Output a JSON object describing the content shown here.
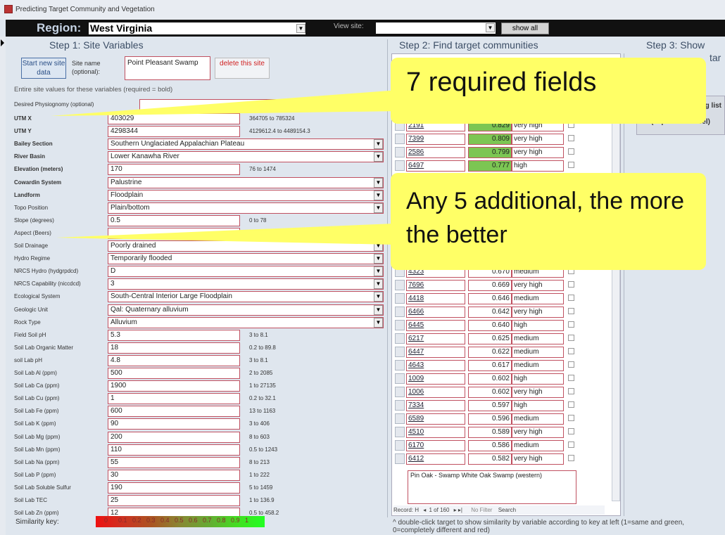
{
  "window": {
    "title": "Predicting Target Community and Vegetation"
  },
  "topbar": {
    "region_label": "Region:",
    "region_value": "West Virginia",
    "view_site_label": "View site:",
    "view_site_value": "",
    "show_all_label": "show all"
  },
  "step1": {
    "title": "Step 1: Site Variables",
    "start_new_label": "Start new site data",
    "site_name_label": "Site name (optional):",
    "site_name_value": "Point Pleasant Swamp",
    "delete_label": "delete this site",
    "instructions": "Entire site values for these variables (required = bold)",
    "desired_physiognomy_label": "Desired Physiognomy (optional)",
    "rows": [
      {
        "label": "UTM X",
        "value": "403029",
        "range": "364705 to 785324",
        "bold": true,
        "dropdown": false
      },
      {
        "label": "UTM Y",
        "value": "4298344",
        "range": "4129612.4 to 4489154.3",
        "bold": true,
        "dropdown": false
      },
      {
        "label": "Bailey Section",
        "value": "Southern Unglaciated Appalachian Plateau",
        "range": "",
        "bold": true,
        "dropdown": true
      },
      {
        "label": "River Basin",
        "value": "Lower Kanawha River",
        "range": "",
        "bold": true,
        "dropdown": true
      },
      {
        "label": "Elevation (meters)",
        "value": "170",
        "range": "76 to 1474",
        "bold": true,
        "dropdown": false
      },
      {
        "label": "Cowardin System",
        "value": "Palustrine",
        "range": "",
        "bold": true,
        "dropdown": true
      },
      {
        "label": "Landform",
        "value": "Floodplain",
        "range": "",
        "bold": true,
        "dropdown": true
      },
      {
        "label": "Topo Position",
        "value": "Plain/bottom",
        "range": "",
        "bold": false,
        "dropdown": true
      },
      {
        "label": "Slope (degrees)",
        "value": "0.5",
        "range": "0 to 78",
        "bold": false,
        "dropdown": false
      },
      {
        "label": "Aspect (Beers)",
        "value": "",
        "range": "0 to 1",
        "bold": false,
        "dropdown": false
      },
      {
        "label": "Soil Drainage",
        "value": "Poorly drained",
        "range": "",
        "bold": false,
        "dropdown": true
      },
      {
        "label": "Hydro Regime",
        "value": "Temporarily flooded",
        "range": "",
        "bold": false,
        "dropdown": true
      },
      {
        "label": "NRCS Hydro (hydgrpdcd)",
        "value": "D",
        "range": "",
        "bold": false,
        "dropdown": true
      },
      {
        "label": "NRCS Capability (niccdcd)",
        "value": "3",
        "range": "",
        "bold": false,
        "dropdown": true
      },
      {
        "label": "Ecological System",
        "value": "South-Central Interior Large Floodplain",
        "range": "",
        "bold": false,
        "dropdown": true
      },
      {
        "label": "Geologic Unit",
        "value": "Qal: Quaternary alluvium",
        "range": "",
        "bold": false,
        "dropdown": true
      },
      {
        "label": "Rock Type",
        "value": "Alluvium",
        "range": "",
        "bold": false,
        "dropdown": true
      },
      {
        "label": "Field Soil pH",
        "value": "5.3",
        "range": "3 to 8.1",
        "bold": false,
        "dropdown": false
      },
      {
        "label": "Soil Lab Organic Matter",
        "value": "18",
        "range": "0.2 to 89.8",
        "bold": false,
        "dropdown": false
      },
      {
        "label": "soil Lab pH",
        "value": "4.8",
        "range": "3 to 8.1",
        "bold": false,
        "dropdown": false
      },
      {
        "label": "Soil Lab Al (ppm)",
        "value": "500",
        "range": "2 to 2085",
        "bold": false,
        "dropdown": false
      },
      {
        "label": "Soil Lab Ca (ppm)",
        "value": "1900",
        "range": "1 to 27135",
        "bold": false,
        "dropdown": false
      },
      {
        "label": "Soil Lab Cu (ppm)",
        "value": "1",
        "range": "0.2 to 32.1",
        "bold": false,
        "dropdown": false
      },
      {
        "label": "Soil Lab Fe (ppm)",
        "value": "600",
        "range": "13 to 1163",
        "bold": false,
        "dropdown": false
      },
      {
        "label": "Soil Lab K (ppm)",
        "value": "90",
        "range": "3 to 406",
        "bold": false,
        "dropdown": false
      },
      {
        "label": "Soil Lab Mg (ppm)",
        "value": "200",
        "range": "8 to 603",
        "bold": false,
        "dropdown": false
      },
      {
        "label": "Soil Lab Mn (ppm)",
        "value": "110",
        "range": "0.5 to 1243",
        "bold": false,
        "dropdown": false
      },
      {
        "label": "Soil Lab Na (ppm)",
        "value": "55",
        "range": "8 to 213",
        "bold": false,
        "dropdown": false
      },
      {
        "label": "Soil Lab P (ppm)",
        "value": "30",
        "range": "1 to 222",
        "bold": false,
        "dropdown": false
      },
      {
        "label": "Soil Lab Soluble Sulfur",
        "value": "190",
        "range": "5 to 1459",
        "bold": false,
        "dropdown": false
      },
      {
        "label": "Soil Lab TEC",
        "value": "25",
        "range": "1 to 136.9",
        "bold": false,
        "dropdown": false
      },
      {
        "label": "Soil Lab Zn (ppm)",
        "value": "12",
        "range": "0.5 to 458.2",
        "bold": false,
        "dropdown": false
      }
    ],
    "similarity_key_label": "Similarity key:",
    "similarity_key_values": [
      "0",
      "0.1",
      "0.2",
      "0.3",
      "0.4",
      "0.5",
      "0.6",
      "0.7",
      "0.8",
      "0.9",
      "1"
    ]
  },
  "step2": {
    "title": "Step 2: Find target communities",
    "results": [
      {
        "id": "2191",
        "score": "0.829",
        "level": "very high"
      },
      {
        "id": "7399",
        "score": "0.809",
        "level": "very high"
      },
      {
        "id": "2586",
        "score": "0.799",
        "level": "very high"
      },
      {
        "id": "6497",
        "score": "0.777",
        "level": "high"
      },
      {
        "id": "4323",
        "score": "0.670",
        "level": "medium"
      },
      {
        "id": "7696",
        "score": "0.669",
        "level": "very high"
      },
      {
        "id": "4418",
        "score": "0.646",
        "level": "medium"
      },
      {
        "id": "6466",
        "score": "0.642",
        "level": "very high"
      },
      {
        "id": "6445",
        "score": "0.640",
        "level": "high"
      },
      {
        "id": "6217",
        "score": "0.625",
        "level": "medium"
      },
      {
        "id": "6447",
        "score": "0.622",
        "level": "medium"
      },
      {
        "id": "4643",
        "score": "0.617",
        "level": "medium"
      },
      {
        "id": "1009",
        "score": "0.602",
        "level": "high"
      },
      {
        "id": "1006",
        "score": "0.602",
        "level": "very high"
      },
      {
        "id": "7334",
        "score": "0.597",
        "level": "high"
      },
      {
        "id": "6589",
        "score": "0.596",
        "level": "medium"
      },
      {
        "id": "4510",
        "score": "0.589",
        "level": "very high"
      },
      {
        "id": "6170",
        "score": "0.586",
        "level": "medium"
      },
      {
        "id": "6412",
        "score": "0.582",
        "level": "very high"
      }
    ],
    "description": "Pin Oak - Swamp White Oak Swamp (western)",
    "record_label": "Record: H",
    "record_pos": "1 of 160",
    "no_filter": "No Filter",
    "search": "Search",
    "footnote": "^ double-click target to show similarity by variable according to key at left (1=same and green, 0=completely different and red)"
  },
  "step3": {
    "title_line1": "Step 3: Show",
    "title_line2": "tar",
    "list_label": "g list",
    "export_label": "(exports to Excel)"
  },
  "callouts": {
    "required": "7 required fields",
    "additional": "Any 5 additional, the more the better"
  }
}
